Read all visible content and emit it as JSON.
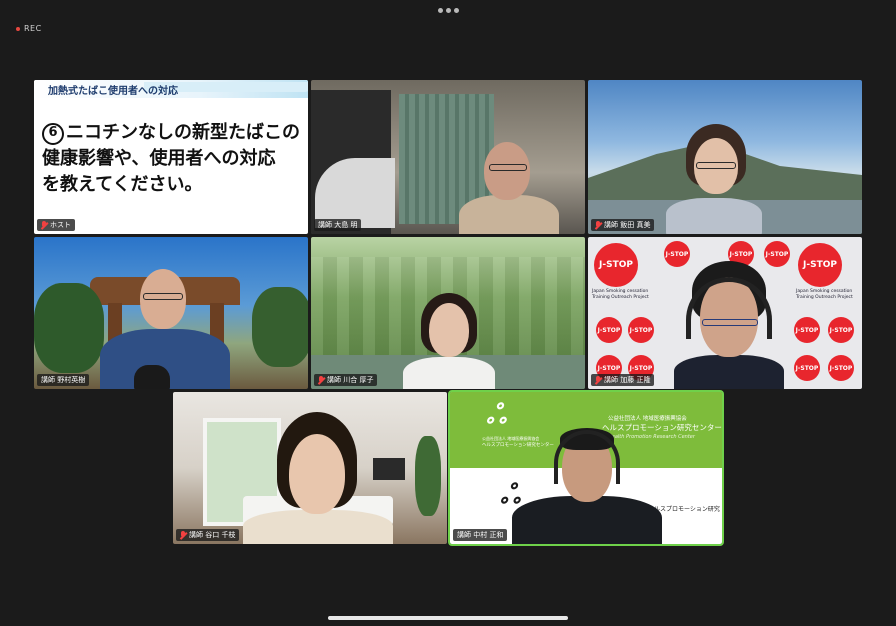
{
  "top": {
    "rec_label": "REC"
  },
  "slide": {
    "title": "加熱式たばこ使用者への対応",
    "number": "6",
    "line1": "ニコチンなしの新型たばこの",
    "line2": "健康影響や、使用者への対応",
    "line3": "を教えてください。"
  },
  "participants": [
    {
      "name": "ホスト",
      "muted": true
    },
    {
      "name": "講師 大島 明",
      "muted": false
    },
    {
      "name": "講師 飯田 真美",
      "muted": true
    },
    {
      "name": "講師 野村英樹",
      "muted": false
    },
    {
      "name": "講師 川合 厚子",
      "muted": true
    },
    {
      "name": "講師 加藤 正隆",
      "muted": true
    },
    {
      "name": "講師 谷口 千枝",
      "muted": true
    },
    {
      "name": "講師 中村 正和",
      "muted": false,
      "active": true
    }
  ],
  "jstop": {
    "logo_text": "J-STOP",
    "caption": "Japan Smoking cessation Training Outreach Project"
  },
  "hprc": {
    "org_small": "公益社団法人 地域医療振興協会",
    "org_name": "ヘルスプロモーション研究センター",
    "org_en": "Health Promotion Research Center"
  },
  "colors": {
    "active_border": "#6fd14a",
    "muted_mic": "#f24141"
  }
}
